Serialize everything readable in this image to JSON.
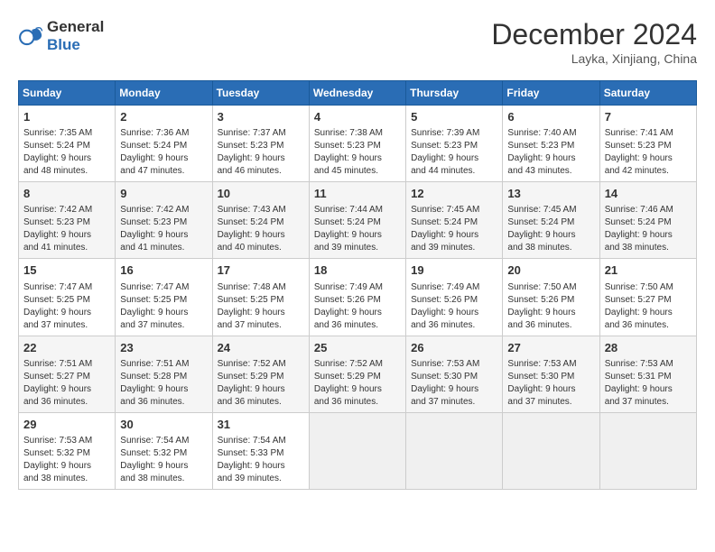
{
  "logo": {
    "line1": "General",
    "line2": "Blue"
  },
  "title": "December 2024",
  "subtitle": "Layka, Xinjiang, China",
  "headers": [
    "Sunday",
    "Monday",
    "Tuesday",
    "Wednesday",
    "Thursday",
    "Friday",
    "Saturday"
  ],
  "weeks": [
    [
      {
        "day": "1",
        "info": "Sunrise: 7:35 AM\nSunset: 5:24 PM\nDaylight: 9 hours\nand 48 minutes."
      },
      {
        "day": "2",
        "info": "Sunrise: 7:36 AM\nSunset: 5:24 PM\nDaylight: 9 hours\nand 47 minutes."
      },
      {
        "day": "3",
        "info": "Sunrise: 7:37 AM\nSunset: 5:23 PM\nDaylight: 9 hours\nand 46 minutes."
      },
      {
        "day": "4",
        "info": "Sunrise: 7:38 AM\nSunset: 5:23 PM\nDaylight: 9 hours\nand 45 minutes."
      },
      {
        "day": "5",
        "info": "Sunrise: 7:39 AM\nSunset: 5:23 PM\nDaylight: 9 hours\nand 44 minutes."
      },
      {
        "day": "6",
        "info": "Sunrise: 7:40 AM\nSunset: 5:23 PM\nDaylight: 9 hours\nand 43 minutes."
      },
      {
        "day": "7",
        "info": "Sunrise: 7:41 AM\nSunset: 5:23 PM\nDaylight: 9 hours\nand 42 minutes."
      }
    ],
    [
      {
        "day": "8",
        "info": "Sunrise: 7:42 AM\nSunset: 5:23 PM\nDaylight: 9 hours\nand 41 minutes."
      },
      {
        "day": "9",
        "info": "Sunrise: 7:42 AM\nSunset: 5:23 PM\nDaylight: 9 hours\nand 41 minutes."
      },
      {
        "day": "10",
        "info": "Sunrise: 7:43 AM\nSunset: 5:24 PM\nDaylight: 9 hours\nand 40 minutes."
      },
      {
        "day": "11",
        "info": "Sunrise: 7:44 AM\nSunset: 5:24 PM\nDaylight: 9 hours\nand 39 minutes."
      },
      {
        "day": "12",
        "info": "Sunrise: 7:45 AM\nSunset: 5:24 PM\nDaylight: 9 hours\nand 39 minutes."
      },
      {
        "day": "13",
        "info": "Sunrise: 7:45 AM\nSunset: 5:24 PM\nDaylight: 9 hours\nand 38 minutes."
      },
      {
        "day": "14",
        "info": "Sunrise: 7:46 AM\nSunset: 5:24 PM\nDaylight: 9 hours\nand 38 minutes."
      }
    ],
    [
      {
        "day": "15",
        "info": "Sunrise: 7:47 AM\nSunset: 5:25 PM\nDaylight: 9 hours\nand 37 minutes."
      },
      {
        "day": "16",
        "info": "Sunrise: 7:47 AM\nSunset: 5:25 PM\nDaylight: 9 hours\nand 37 minutes."
      },
      {
        "day": "17",
        "info": "Sunrise: 7:48 AM\nSunset: 5:25 PM\nDaylight: 9 hours\nand 37 minutes."
      },
      {
        "day": "18",
        "info": "Sunrise: 7:49 AM\nSunset: 5:26 PM\nDaylight: 9 hours\nand 36 minutes."
      },
      {
        "day": "19",
        "info": "Sunrise: 7:49 AM\nSunset: 5:26 PM\nDaylight: 9 hours\nand 36 minutes."
      },
      {
        "day": "20",
        "info": "Sunrise: 7:50 AM\nSunset: 5:26 PM\nDaylight: 9 hours\nand 36 minutes."
      },
      {
        "day": "21",
        "info": "Sunrise: 7:50 AM\nSunset: 5:27 PM\nDaylight: 9 hours\nand 36 minutes."
      }
    ],
    [
      {
        "day": "22",
        "info": "Sunrise: 7:51 AM\nSunset: 5:27 PM\nDaylight: 9 hours\nand 36 minutes."
      },
      {
        "day": "23",
        "info": "Sunrise: 7:51 AM\nSunset: 5:28 PM\nDaylight: 9 hours\nand 36 minutes."
      },
      {
        "day": "24",
        "info": "Sunrise: 7:52 AM\nSunset: 5:29 PM\nDaylight: 9 hours\nand 36 minutes."
      },
      {
        "day": "25",
        "info": "Sunrise: 7:52 AM\nSunset: 5:29 PM\nDaylight: 9 hours\nand 36 minutes."
      },
      {
        "day": "26",
        "info": "Sunrise: 7:53 AM\nSunset: 5:30 PM\nDaylight: 9 hours\nand 37 minutes."
      },
      {
        "day": "27",
        "info": "Sunrise: 7:53 AM\nSunset: 5:30 PM\nDaylight: 9 hours\nand 37 minutes."
      },
      {
        "day": "28",
        "info": "Sunrise: 7:53 AM\nSunset: 5:31 PM\nDaylight: 9 hours\nand 37 minutes."
      }
    ],
    [
      {
        "day": "29",
        "info": "Sunrise: 7:53 AM\nSunset: 5:32 PM\nDaylight: 9 hours\nand 38 minutes."
      },
      {
        "day": "30",
        "info": "Sunrise: 7:54 AM\nSunset: 5:32 PM\nDaylight: 9 hours\nand 38 minutes."
      },
      {
        "day": "31",
        "info": "Sunrise: 7:54 AM\nSunset: 5:33 PM\nDaylight: 9 hours\nand 39 minutes."
      },
      {
        "day": "",
        "info": ""
      },
      {
        "day": "",
        "info": ""
      },
      {
        "day": "",
        "info": ""
      },
      {
        "day": "",
        "info": ""
      }
    ]
  ]
}
